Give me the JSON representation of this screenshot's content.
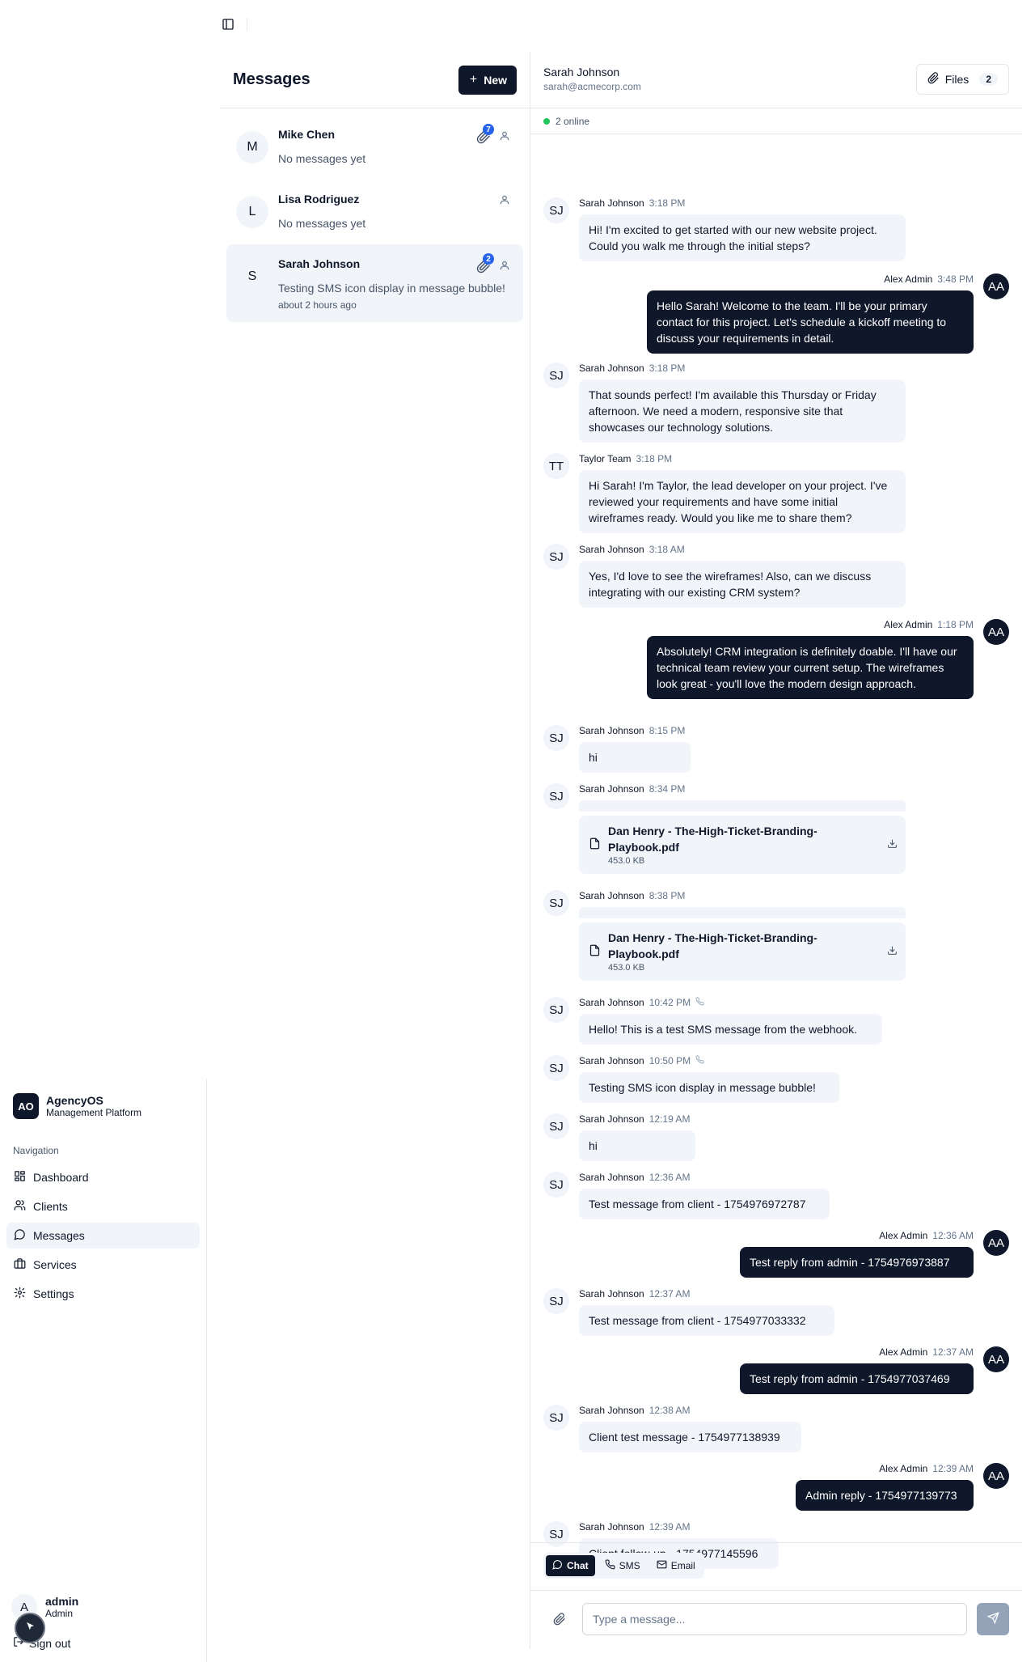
{
  "brand": {
    "logo": "AO",
    "name": "AgencyOS",
    "subtitle": "Management Platform"
  },
  "nav": {
    "heading": "Navigation",
    "items": [
      {
        "label": "Dashboard",
        "icon": "dashboard-icon"
      },
      {
        "label": "Clients",
        "icon": "users-icon"
      },
      {
        "label": "Messages",
        "icon": "message-icon"
      },
      {
        "label": "Services",
        "icon": "briefcase-icon"
      },
      {
        "label": "Settings",
        "icon": "gear-icon"
      }
    ],
    "active": "Messages"
  },
  "user": {
    "initial": "A",
    "name": "admin",
    "role": "Admin",
    "signout_label": "Sign out"
  },
  "conversations": {
    "title": "Messages",
    "new_label": "New",
    "items": [
      {
        "initial": "M",
        "name": "Mike Chen",
        "preview": "No messages yet",
        "time": "",
        "badge": "7"
      },
      {
        "initial": "L",
        "name": "Lisa Rodriguez",
        "preview": "No messages yet",
        "time": "",
        "badge": ""
      },
      {
        "initial": "S",
        "name": "Sarah Johnson",
        "preview": "Testing SMS icon display in message bubble!",
        "time": "about 2 hours ago",
        "badge": "2"
      }
    ]
  },
  "chat": {
    "contact_name": "Sarah Johnson",
    "contact_email": "sarah@acmecorp.com",
    "files_label": "Files",
    "files_count": "2",
    "online_text": "2 online",
    "messages": [
      {
        "author": "Sarah Johnson",
        "initials": "SJ",
        "time": "3:18 PM",
        "text": "Hi! I'm excited to get started with our new website project. Could you walk me through the initial steps?"
      },
      {
        "author": "Alex Admin",
        "initials": "AA",
        "time": "3:48 PM",
        "text": "Hello Sarah! Welcome to the team. I'll be your primary contact for this project. Let's schedule a kickoff meeting to discuss your requirements in detail."
      },
      {
        "author": "Sarah Johnson",
        "initials": "SJ",
        "time": "3:18 PM",
        "text": "That sounds perfect! I'm available this Thursday or Friday afternoon. We need a modern, responsive site that showcases our technology solutions."
      },
      {
        "author": "Taylor Team",
        "initials": "TT",
        "time": "3:18 PM",
        "text": "Hi Sarah! I'm Taylor, the lead developer on your project. I've reviewed your requirements and have some initial wireframes ready. Would you like me to share them?"
      },
      {
        "author": "Sarah Johnson",
        "initials": "SJ",
        "time": "3:18 AM",
        "text": "Yes, I'd love to see the wireframes! Also, can we discuss integrating with our existing CRM system?"
      },
      {
        "author": "Alex Admin",
        "initials": "AA",
        "time": "1:18 PM",
        "text": "Absolutely! CRM integration is definitely doable. I'll have our technical team review your current setup. The wireframes look great - you'll love the modern design approach."
      },
      {
        "author": "Sarah Johnson",
        "initials": "SJ",
        "time": "8:15 PM",
        "text": "hi"
      },
      {
        "author": "Sarah Johnson",
        "initials": "SJ",
        "time": "8:34 PM",
        "file_name": "Dan Henry - The-High-Ticket-Branding-Playbook.pdf",
        "file_size": "453.0 KB"
      },
      {
        "author": "Sarah Johnson",
        "initials": "SJ",
        "time": "8:38 PM",
        "file_name": "Dan Henry - The-High-Ticket-Branding-Playbook.pdf",
        "file_size": "453.0 KB"
      },
      {
        "author": "Sarah Johnson",
        "initials": "SJ",
        "time": "10:42 PM",
        "text": "Hello! This is a test SMS message from the webhook.",
        "sms": true
      },
      {
        "author": "Sarah Johnson",
        "initials": "SJ",
        "time": "10:50 PM",
        "text": "Testing SMS icon display in message bubble!",
        "sms": true
      },
      {
        "author": "Sarah Johnson",
        "initials": "SJ",
        "time": "12:19 AM",
        "text": "hi"
      },
      {
        "author": "Sarah Johnson",
        "initials": "SJ",
        "time": "12:36 AM",
        "text": "Test message from client - 1754976972787"
      },
      {
        "author": "Alex Admin",
        "initials": "AA",
        "time": "12:36 AM",
        "text": "Test reply from admin - 1754976973887"
      },
      {
        "author": "Sarah Johnson",
        "initials": "SJ",
        "time": "12:37 AM",
        "text": "Test message from client - 1754977033332"
      },
      {
        "author": "Alex Admin",
        "initials": "AA",
        "time": "12:37 AM",
        "text": "Test reply from admin - 1754977037469"
      },
      {
        "author": "Sarah Johnson",
        "initials": "SJ",
        "time": "12:38 AM",
        "text": "Client test message - 1754977138939"
      },
      {
        "author": "Alex Admin",
        "initials": "AA",
        "time": "12:39 AM",
        "text": "Admin reply - 1754977139773"
      },
      {
        "author": "Sarah Johnson",
        "initials": "SJ",
        "time": "12:39 AM",
        "text": "Client follow-up - 1754977145596"
      }
    ]
  },
  "composer": {
    "modes": [
      "Chat",
      "SMS",
      "Email"
    ],
    "active_mode": "Chat",
    "placeholder": "Type a message..."
  },
  "colors": {
    "primary": "#0f172a",
    "muted_bg": "#f1f5f9",
    "badge": "#2563eb",
    "online": "#22c55e"
  }
}
